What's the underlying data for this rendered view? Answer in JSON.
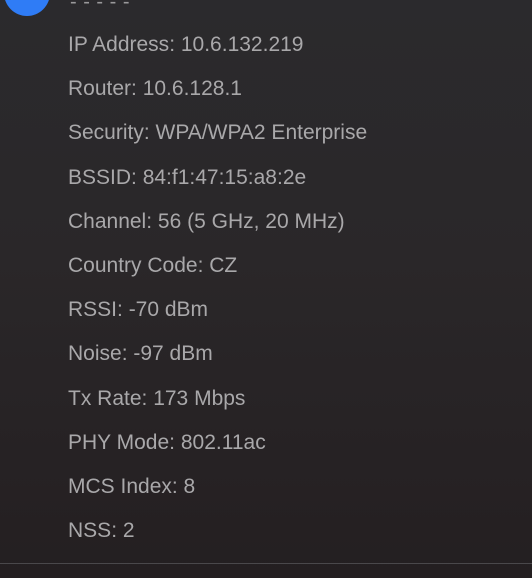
{
  "header": {
    "title_fragment": "- - - - -"
  },
  "details": [
    {
      "label": "IP Address",
      "value": "10.6.132.219"
    },
    {
      "label": "Router",
      "value": "10.6.128.1"
    },
    {
      "label": "Security",
      "value": "WPA/WPA2 Enterprise"
    },
    {
      "label": "BSSID",
      "value": "84:f1:47:15:a8:2e"
    },
    {
      "label": "Channel",
      "value": "56 (5 GHz, 20 MHz)"
    },
    {
      "label": "Country Code",
      "value": "CZ"
    },
    {
      "label": "RSSI",
      "value": "-70 dBm"
    },
    {
      "label": "Noise",
      "value": "-97 dBm"
    },
    {
      "label": "Tx Rate",
      "value": "173 Mbps"
    },
    {
      "label": "PHY Mode",
      "value": "802.11ac"
    },
    {
      "label": "MCS Index",
      "value": "8"
    },
    {
      "label": "NSS",
      "value": "2"
    }
  ],
  "colors": {
    "accent": "#2f7cf6",
    "text": "#a9a8aa",
    "background": "#2a2729"
  }
}
